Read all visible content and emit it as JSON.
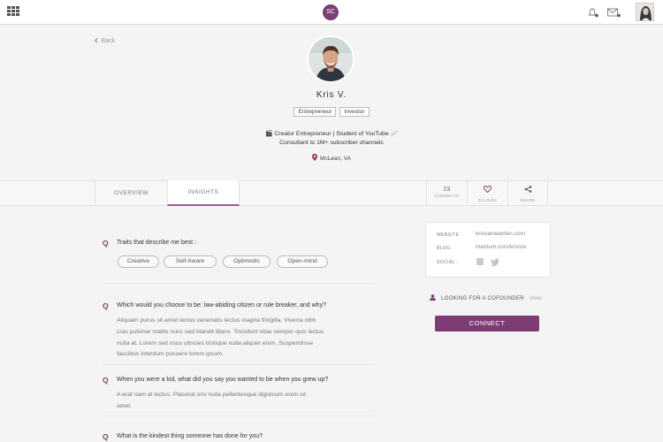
{
  "topbar": {
    "logo_text": "SC",
    "accent_color": "#7b3f73",
    "icons": [
      "menu-grid-icon",
      "bell-icon",
      "mail-icon"
    ]
  },
  "back_label": "Back",
  "profile": {
    "name": "Kris V.",
    "tags": [
      "Entrepreneur",
      "Investor"
    ],
    "bio_line1": "🎬 Creator Entrepreneur | Student of YouTube 📈",
    "bio_line2": "Consultant to 1M+ subscriber channels",
    "location": "McLean, VA"
  },
  "tabs": [
    "OVERVIEW",
    "INSIGHTS"
  ],
  "active_tab": "INSIGHTS",
  "stats": {
    "connects_count": "23",
    "connects_label": "CONNECTS",
    "likes_label": "32 LIKES",
    "share_label": "SHARE"
  },
  "insights": {
    "traits_question": "Traits that describe me best :",
    "traits": [
      "Creative",
      "Self Aware",
      "Optimistic",
      "Open-mind"
    ],
    "questions": [
      {
        "q": "Which would you choose to be: law-abiding citizen or rule breaker, and why?",
        "a_lines": [
          "Aliquam purus sit amet lectus venenatis lectus magna fringilla. Viverra nibh",
          "cras pulvinar mattis nunc sed blandit libero. Tincidunt vitae semper quis lectus",
          "nulla at. Lorem sed risus ultricies tristique nulla aliquet enim. Suspendisse",
          "faucibus interdum posuere lorem ipsum."
        ]
      },
      {
        "q": "When you were a kid, what did you say you wanted to be when you grew up?",
        "a_lines": [
          "A erat nam at lectus. Placerat orci nulla pellentesque dignissim enim sit",
          "amet."
        ]
      },
      {
        "q": "What is the kindest thing someone has done for you?",
        "a_lines": []
      }
    ]
  },
  "links": {
    "website_label": "WEBSITE :",
    "website_value": "krisvanwarden.com",
    "blog_label": "BLOG :",
    "blog_value": "medium.com/krisvw",
    "social_label": "SOCIAL :"
  },
  "cofounder": {
    "label": "LOOKING FOR A COFOUNDER",
    "view": "View"
  },
  "connect_button": "CONNECT"
}
